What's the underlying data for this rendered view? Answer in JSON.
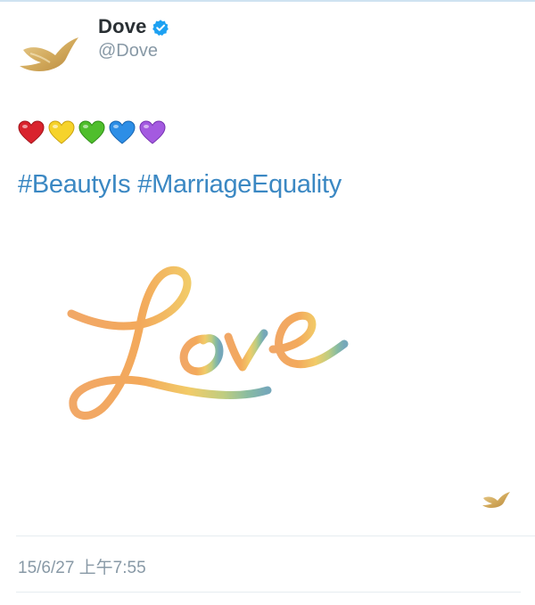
{
  "tweet": {
    "author_name": "Dove",
    "handle": "@Dove",
    "verified": true,
    "avatar_icon": "dove-logo-icon",
    "emoji_hearts": [
      {
        "name": "red-heart-icon",
        "color": "#d9232d"
      },
      {
        "name": "yellow-heart-icon",
        "color": "#f6d32b"
      },
      {
        "name": "green-heart-icon",
        "color": "#4fbe2c"
      },
      {
        "name": "blue-heart-icon",
        "color": "#2d8ee6"
      },
      {
        "name": "purple-heart-icon",
        "color": "#a45ae0"
      }
    ],
    "hashtags": [
      "#BeautyIs",
      "#MarriageEquality"
    ],
    "image": {
      "lettering": "Love",
      "icon": "dove-watermark-icon"
    },
    "timestamp": "15/6/27 上午7:55"
  },
  "colors": {
    "link": "#3b88c3",
    "muted": "#8899a6",
    "verified": "#1da1f2",
    "dove_gold": "#d7b36a"
  }
}
